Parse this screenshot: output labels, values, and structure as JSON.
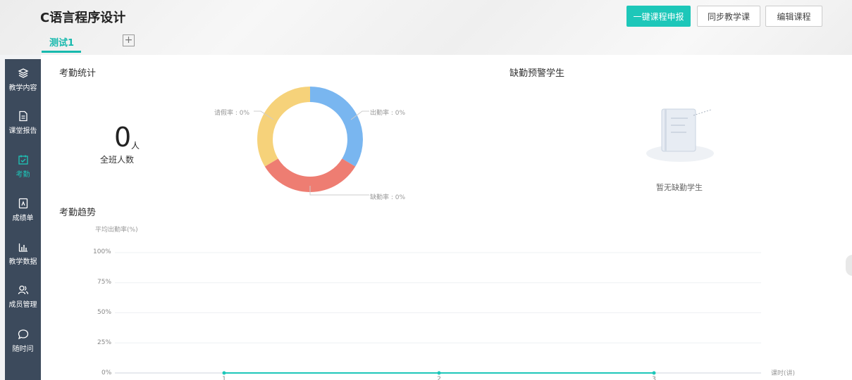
{
  "header": {
    "course_title": "C语言程序设计",
    "tab_label": "测试1",
    "add_tab_icon": "plus-square-icon",
    "buttons": {
      "report": "一键课程申报",
      "sync": "同步教学课",
      "edit": "编辑课程"
    },
    "accent_color": "#1dc7b9"
  },
  "sidebar": {
    "items": [
      {
        "label": "教学内容",
        "icon": "layers-icon"
      },
      {
        "label": "课堂报告",
        "icon": "document-icon"
      },
      {
        "label": "考勤",
        "icon": "calendar-check-icon",
        "active": true
      },
      {
        "label": "成绩单",
        "icon": "grade-sheet-icon"
      },
      {
        "label": "教学数据",
        "icon": "bar-chart-icon"
      },
      {
        "label": "成员管理",
        "icon": "users-icon"
      },
      {
        "label": "随时问",
        "icon": "chat-icon"
      }
    ]
  },
  "attendance_stats": {
    "title": "考勤统计",
    "total_count": "0",
    "total_unit": "人",
    "total_label": "全班人数",
    "donut_labels": {
      "leave": "请假率 : 0%",
      "attend": "出勤率 : 0%",
      "absent": "缺勤率 : 0%"
    },
    "colors": {
      "attend": "#79b6f0",
      "absent": "#ee7d72",
      "leave": "#f6d27a"
    }
  },
  "absence_warning": {
    "title": "缺勤预警学生",
    "empty_text": "暂无缺勤学生",
    "empty_icon": "empty-notebook-icon"
  },
  "trend": {
    "title": "考勤趋势"
  },
  "chart_data": {
    "type": "line",
    "ylabel": "平均出勤率(%)",
    "xlabel": "课时(讲)",
    "ylim": [
      0,
      100
    ],
    "yticks": [
      "100%",
      "75%",
      "50%",
      "25%",
      "0%"
    ],
    "x": [
      "1",
      "2",
      "3"
    ],
    "series": [
      {
        "values": [
          0,
          0,
          0
        ]
      }
    ],
    "line_color": "#1dc7b9",
    "grid": true
  }
}
